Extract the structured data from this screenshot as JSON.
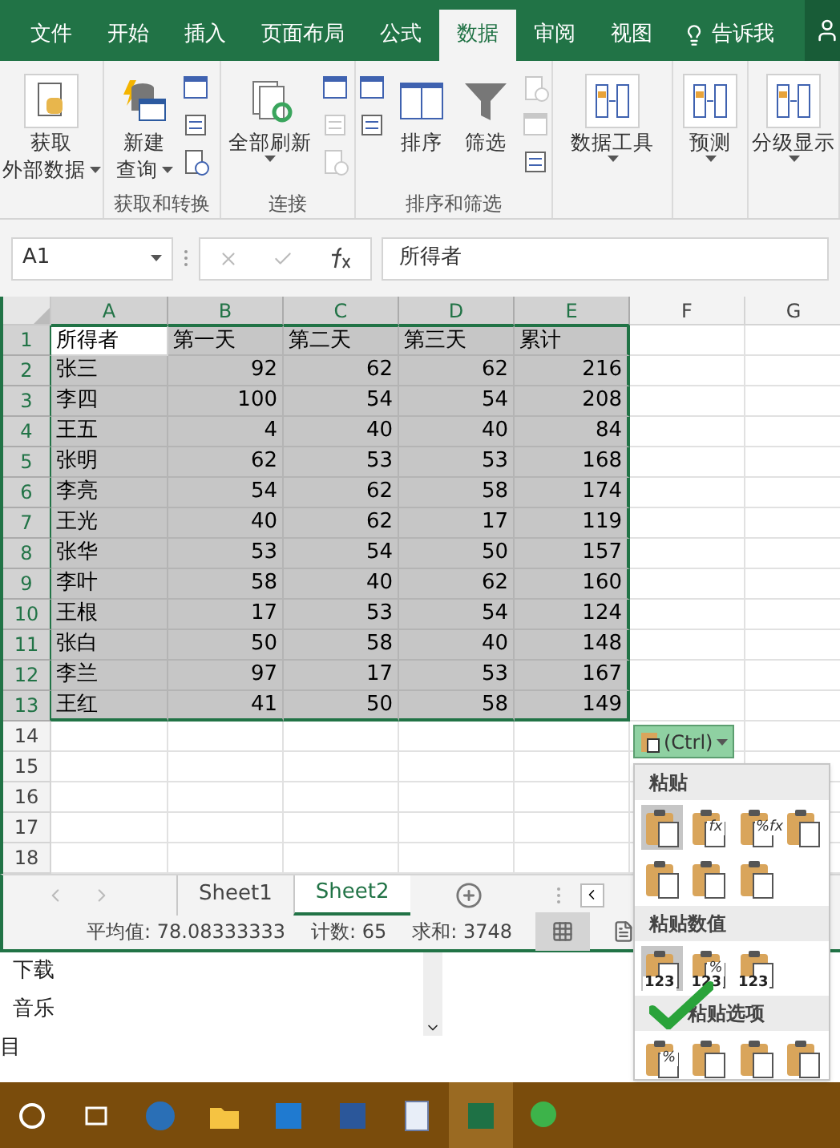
{
  "ribbon_tabs": [
    {
      "label": "文件",
      "selected": false
    },
    {
      "label": "开始",
      "selected": false
    },
    {
      "label": "插入",
      "selected": false
    },
    {
      "label": "页面布局",
      "selected": false
    },
    {
      "label": "公式",
      "selected": false
    },
    {
      "label": "数据",
      "selected": true
    },
    {
      "label": "审阅",
      "selected": false
    },
    {
      "label": "视图",
      "selected": false
    }
  ],
  "tell_me": "告诉我",
  "ribbon_groups": [
    {
      "items": [
        {
          "kind": "large",
          "lines": [
            "获取",
            "外部数据"
          ],
          "dropdown": true,
          "framed": true
        }
      ]
    },
    {
      "label": "获取和转换",
      "items": [
        {
          "kind": "large",
          "lines": [
            "新建",
            "查询"
          ],
          "dropdown": true,
          "framed": false
        },
        {
          "kind": "stack",
          "icons": [
            {
              "disabled": false
            },
            {
              "disabled": false
            },
            {
              "disabled": false
            }
          ]
        }
      ]
    },
    {
      "label": "连接",
      "items": [
        {
          "kind": "large",
          "lines": [
            "全部刷新"
          ],
          "dropdown": true,
          "framed": false
        },
        {
          "kind": "stack",
          "icons": [
            {
              "disabled": false
            },
            {
              "disabled": true
            },
            {
              "disabled": true
            }
          ]
        }
      ]
    },
    {
      "label": "排序和筛选",
      "items": [
        {
          "kind": "stack",
          "icons": [
            {
              "disabled": false
            },
            {
              "disabled": false
            }
          ]
        },
        {
          "kind": "large",
          "lines": [
            "排序"
          ],
          "dropdown": false,
          "framed": false
        },
        {
          "kind": "large",
          "lines": [
            "筛选"
          ],
          "dropdown": false,
          "framed": false
        },
        {
          "kind": "stack",
          "icons": [
            {
              "disabled": true
            },
            {
              "disabled": true
            },
            {
              "disabled": false
            }
          ]
        }
      ]
    },
    {
      "items": [
        {
          "kind": "large",
          "lines": [
            "数据工具"
          ],
          "dropdown": true,
          "framed": true
        }
      ]
    },
    {
      "items": [
        {
          "kind": "large",
          "lines": [
            "预测"
          ],
          "dropdown": true,
          "framed": true
        }
      ]
    },
    {
      "items": [
        {
          "kind": "large",
          "lines": [
            "分级显示"
          ],
          "dropdown": true,
          "framed": true
        }
      ]
    }
  ],
  "name_box": "A1",
  "formula": "所得者",
  "columns": [
    {
      "label": "A",
      "selected": true
    },
    {
      "label": "B",
      "selected": true
    },
    {
      "label": "C",
      "selected": true
    },
    {
      "label": "D",
      "selected": true
    },
    {
      "label": "E",
      "selected": true
    },
    {
      "label": "F",
      "selected": false
    },
    {
      "label": "G",
      "selected": false
    }
  ],
  "rows": [
    {
      "label": "1",
      "kind": "header",
      "selected": true,
      "cells": [
        "所得者",
        "第一天",
        "第二天",
        "第三天",
        "累计"
      ]
    },
    {
      "label": "2",
      "kind": "data",
      "selected": true,
      "cells": [
        "张三",
        "92",
        "62",
        "62",
        "216"
      ]
    },
    {
      "label": "3",
      "kind": "data",
      "selected": true,
      "cells": [
        "李四",
        "100",
        "54",
        "54",
        "208"
      ]
    },
    {
      "label": "4",
      "kind": "data",
      "selected": true,
      "cells": [
        "王五",
        "4",
        "40",
        "40",
        "84"
      ]
    },
    {
      "label": "5",
      "kind": "data",
      "selected": true,
      "cells": [
        "张明",
        "62",
        "53",
        "53",
        "168"
      ]
    },
    {
      "label": "6",
      "kind": "data",
      "selected": true,
      "cells": [
        "李亮",
        "54",
        "62",
        "58",
        "174"
      ]
    },
    {
      "label": "7",
      "kind": "data",
      "selected": true,
      "cells": [
        "王光",
        "40",
        "62",
        "17",
        "119"
      ]
    },
    {
      "label": "8",
      "kind": "data",
      "selected": true,
      "cells": [
        "张华",
        "53",
        "54",
        "50",
        "157"
      ]
    },
    {
      "label": "9",
      "kind": "data",
      "selected": true,
      "cells": [
        "李叶",
        "58",
        "40",
        "62",
        "160"
      ]
    },
    {
      "label": "10",
      "kind": "data",
      "selected": true,
      "cells": [
        "王根",
        "17",
        "53",
        "54",
        "124"
      ]
    },
    {
      "label": "11",
      "kind": "data",
      "selected": true,
      "cells": [
        "张白",
        "50",
        "58",
        "40",
        "148"
      ]
    },
    {
      "label": "12",
      "kind": "data",
      "selected": true,
      "cells": [
        "李兰",
        "97",
        "17",
        "53",
        "167"
      ]
    },
    {
      "label": "13",
      "kind": "data",
      "selected": true,
      "cells": [
        "王红",
        "41",
        "50",
        "58",
        "149"
      ]
    },
    {
      "label": "14",
      "kind": "empty",
      "selected": false
    },
    {
      "label": "15",
      "kind": "empty",
      "selected": false
    },
    {
      "label": "16",
      "kind": "empty",
      "selected": false
    },
    {
      "label": "17",
      "kind": "empty",
      "selected": false
    },
    {
      "label": "18",
      "kind": "empty",
      "selected": false
    }
  ],
  "sheets": [
    {
      "label": "Sheet1",
      "selected": false
    },
    {
      "label": "Sheet2",
      "selected": true
    }
  ],
  "status": [
    "平均值: 78.08333333",
    "计数: 65",
    "求和: 3748"
  ],
  "views": [
    {
      "selected": true
    },
    {
      "selected": false
    }
  ],
  "paste_button": "(Ctrl)",
  "paste_menu": [
    {
      "title": "粘贴",
      "options": [
        {
          "selected": true
        },
        {
          "selected": false,
          "mark": "fx"
        },
        {
          "selected": false,
          "mark": "%fx"
        },
        {
          "selected": false
        },
        {
          "selected": false
        },
        {
          "selected": false
        },
        {
          "selected": false
        }
      ]
    },
    {
      "title": "粘贴数值",
      "options": [
        {
          "selected": true,
          "badge": "123"
        },
        {
          "selected": false,
          "mark": "%",
          "badge": "123"
        },
        {
          "selected": false,
          "badge": "123"
        }
      ]
    },
    {
      "title": "粘贴选项",
      "options": [
        {
          "selected": false,
          "mark": "%"
        },
        {
          "selected": false
        },
        {
          "selected": false
        },
        {
          "selected": false
        }
      ]
    }
  ],
  "explorer_items": [
    "下载",
    "音乐",
    "目"
  ],
  "taskbar": [
    {
      "selected": false
    },
    {
      "selected": false
    },
    {
      "selected": false
    },
    {
      "selected": false
    },
    {
      "selected": false
    },
    {
      "selected": false
    },
    {
      "selected": false
    },
    {
      "selected": true
    },
    {
      "selected": false
    }
  ]
}
